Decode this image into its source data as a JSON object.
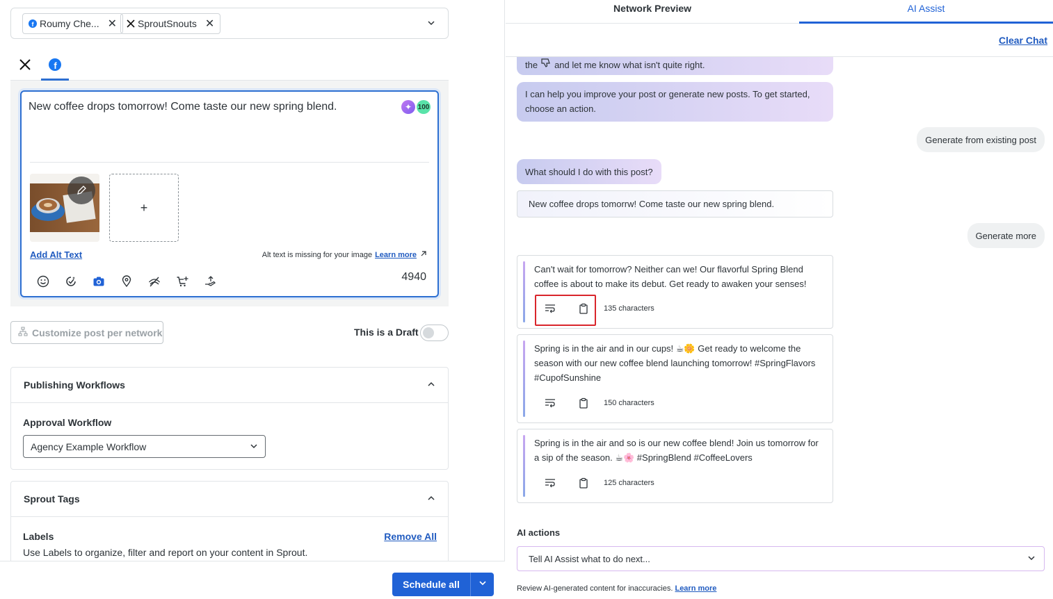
{
  "profiles": {
    "chips": [
      {
        "network": "facebook",
        "label": "Roumy Che...",
        "remove": "✕"
      },
      {
        "network": "x",
        "label": "SproutSnouts",
        "remove": "✕"
      }
    ]
  },
  "network_tabs": [
    {
      "icon": "x-logo-icon",
      "active": false
    },
    {
      "icon": "facebook-logo-icon",
      "active": true
    }
  ],
  "compose": {
    "text": "New coffee drops tomorrow! Come taste our new spring blend.",
    "ai_badge_count": "100",
    "add_media": "+",
    "alt_text_link": "Add Alt Text",
    "alt_text_message": "Alt text is missing for your image",
    "alt_text_learn_more": "Learn more",
    "char_count": "4940",
    "tools": [
      "emoji-icon",
      "smart-icon",
      "camera-icon",
      "location-icon",
      "targeting-icon",
      "shop-icon",
      "hand-icon"
    ]
  },
  "customize_button": "Customize post per network",
  "draft_label": "This is a Draft",
  "publishing": {
    "title": "Publishing Workflows",
    "approval_label": "Approval Workflow",
    "approval_value": "Agency Example Workflow"
  },
  "tags": {
    "title": "Sprout Tags",
    "labels_title": "Labels",
    "remove_all": "Remove All",
    "labels_desc": "Use Labels to organize, filter and report on your content in Sprout."
  },
  "footer": {
    "schedule_label": "Schedule all"
  },
  "right_tabs": {
    "preview": "Network Preview",
    "ai": "AI Assist"
  },
  "clear_chat": "Clear Chat",
  "chat": {
    "ai_msg_top_before": "the",
    "ai_msg_top_after": "and let me know what isn't quite right.",
    "ai_msg_intro": "I can help you improve your post or generate new posts. To get started, choose an action.",
    "user_msg_1": "Generate from existing post",
    "ai_msg_question": "What should I do with this post?",
    "quoted_post": "New coffee drops tomorrw! Come taste our new spring blend.",
    "user_msg_2": "Generate more",
    "suggestions": [
      {
        "text": "Can't wait for tomorrow? Neither can we! Our flavorful Spring Blend coffee is about to make its debut. Get ready to awaken your senses!",
        "count": "135 characters"
      },
      {
        "text": "Spring is in the air and in our cups! ☕🌼 Get ready to welcome the season with our new coffee blend launching tomorrow! #SpringFlavors #CupofSunshine",
        "count": "150 characters"
      },
      {
        "text": "Spring is in the air and so is our new coffee blend! Join us tomorrow for a sip of the season. ☕🌸 #SpringBlend #CoffeeLovers",
        "count": "125 characters"
      }
    ]
  },
  "ai_actions": {
    "label": "AI actions",
    "placeholder": "Tell AI Assist what to do next..."
  },
  "disclaimer": {
    "text": "Review AI-generated content for inaccuracies.",
    "link": "Learn more"
  },
  "colors": {
    "accent": "#2062d6",
    "highlight": "#d9252b"
  }
}
